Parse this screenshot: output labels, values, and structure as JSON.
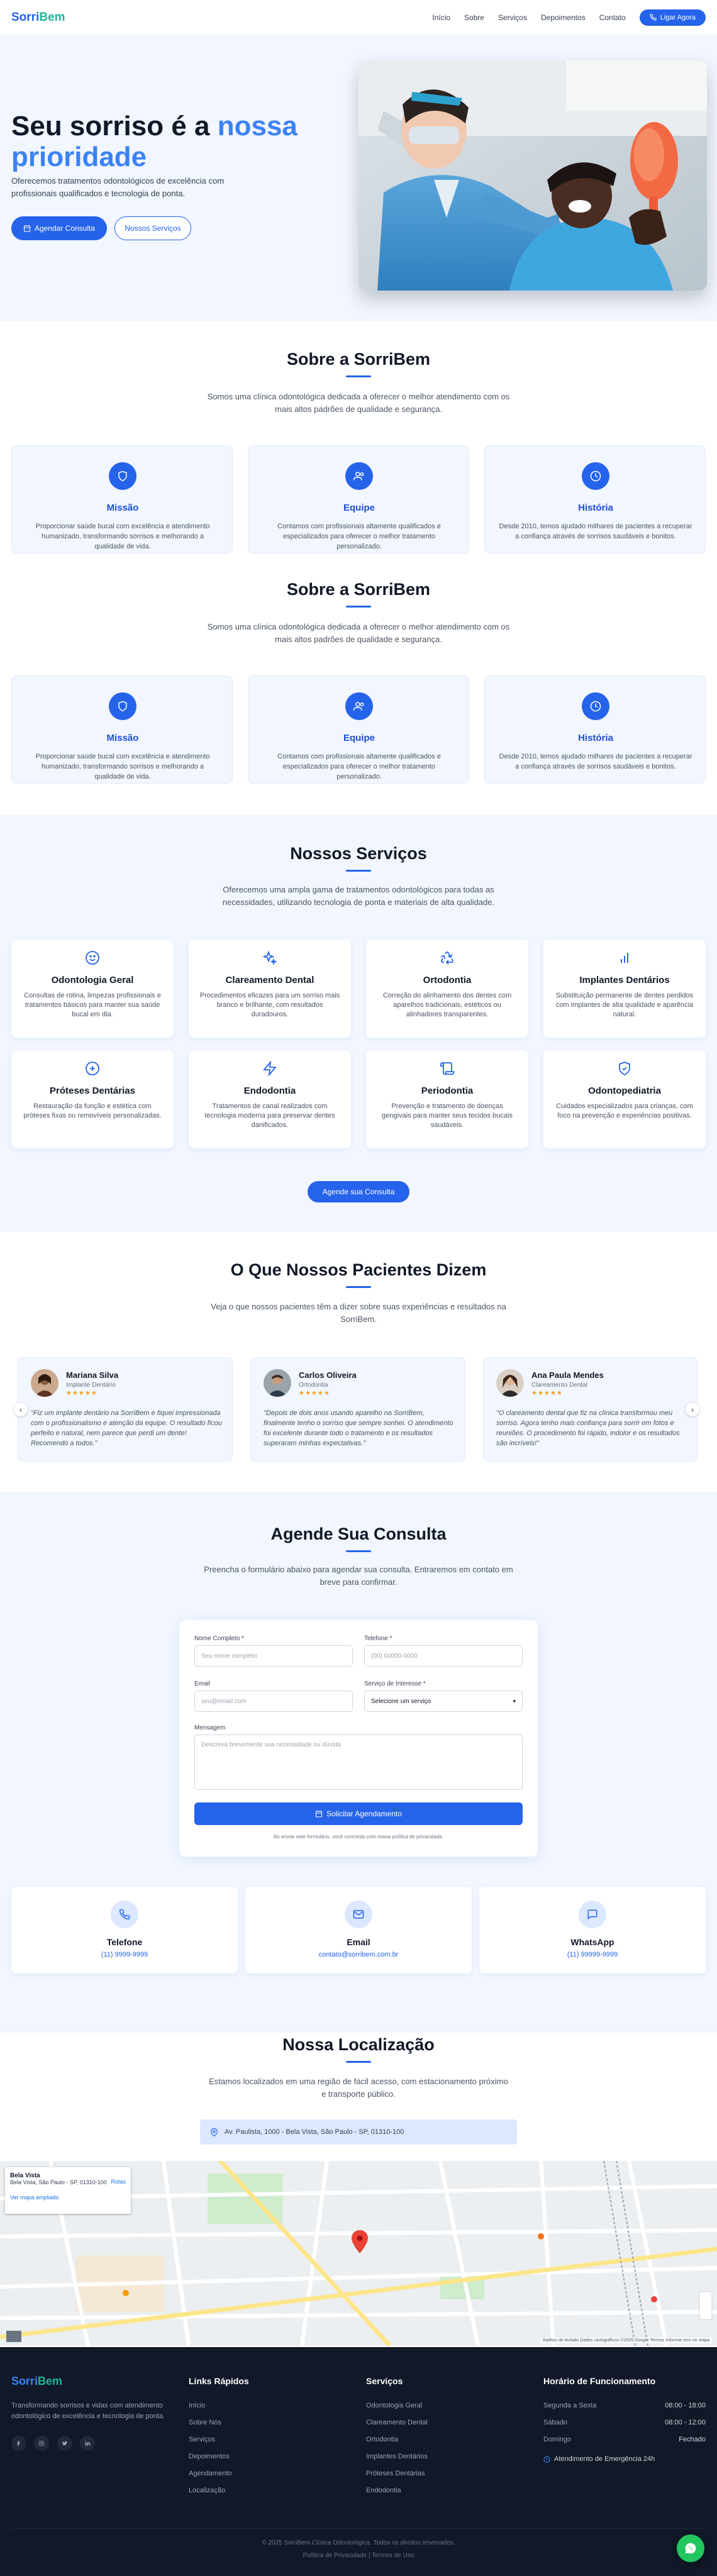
{
  "header": {
    "logo_part1": "Sorri",
    "logo_part2": "Bem",
    "nav": [
      "Início",
      "Sobre",
      "Serviços",
      "Depoimentos",
      "Contato"
    ],
    "cta": "Ligar Agora"
  },
  "hero": {
    "title_line1": "Seu sorriso é a",
    "title_highlight_1": "nossa",
    "title_highlight_2": "prioridade",
    "subtitle": "Oferecemos tratamentos odontológicos de excelência com profissionais qualificados e tecnologia de ponta.",
    "primary_button": "Agendar Consulta",
    "secondary_button": "Nossos Serviços"
  },
  "about": {
    "title": "Sobre a SorriBem",
    "subtitle": "Somos uma clínica odontológica dedicada a oferecer o melhor atendimento com os mais altos padrões de qualidade e segurança.",
    "cards": [
      {
        "title": "Missão",
        "text": "Proporcionar saúde bucal com excelência e atendimento humanizado, transformando sorrisos e melhorando a qualidade de vida."
      },
      {
        "title": "Equipe",
        "text": "Contamos com profissionais altamente qualificados e especializados para oferecer o melhor tratamento personalizado."
      },
      {
        "title": "História",
        "text": "Desde 2010, temos ajudado milhares de pacientes a recuperar a confiança através de sorrisos saudáveis e bonitos."
      }
    ]
  },
  "services": {
    "title": "Nossos Serviços",
    "subtitle": "Oferecemos uma ampla gama de tratamentos odontológicos para todas as necessidades, utilizando tecnologia de ponta e materiais de alta qualidade.",
    "items": [
      {
        "title": "Odontologia Geral",
        "text": "Consultas de rotina, limpezas profissionais e tratamentos básicos para manter sua saúde bucal em dia.",
        "icon": "smile-icon"
      },
      {
        "title": "Clareamento Dental",
        "text": "Procedimentos eficazes para um sorriso mais branco e brilhante, com resultados duradouros.",
        "icon": "sparkles-icon"
      },
      {
        "title": "Ortodontia",
        "text": "Correção do alinhamento dos dentes com aparelhos tradicionais, estéticos ou alinhadores transparentes.",
        "icon": "recycle-icon"
      },
      {
        "title": "Implantes Dentários",
        "text": "Substituição permanente de dentes perdidos com implantes de alta qualidade e aparência natural.",
        "icon": "bar-chart-icon"
      },
      {
        "title": "Próteses Dentárias",
        "text": "Restauração da função e estética com próteses fixas ou removíveis personalizadas.",
        "icon": "plus-circle-icon"
      },
      {
        "title": "Endodontia",
        "text": "Tratamentos de canal realizados com tecnologia moderna para preservar dentes danificados.",
        "icon": "lightning-icon"
      },
      {
        "title": "Periodontia",
        "text": "Prevenção e tratamento de doenças gengivais para manter seus tecidos bucais saudáveis.",
        "icon": "scroll-icon"
      },
      {
        "title": "Odontopediatria",
        "text": "Cuidados especializados para crianças, com foco na prevenção e experiências positivas.",
        "icon": "shield-check-icon"
      }
    ],
    "button": "Agende sua Consulta"
  },
  "testimonials": {
    "title": "O Que Nossos Pacientes Dizem",
    "subtitle": "Veja o que nossos pacientes têm a dizer sobre suas experiências e resultados na SorriBem.",
    "items": [
      {
        "name": "Mariana Silva",
        "role": "Implante Dentário",
        "stars": "★★★★★",
        "text": "\"Fiz um implante dentário na SorriBem e fiquei impressionada com o profissionalismo e atenção da equipe. O resultado ficou perfeito e natural, nem parece que perdi um dente! Recomendo a todos.\""
      },
      {
        "name": "Carlos Oliveira",
        "role": "Ortodontia",
        "stars": "★★★★★",
        "text": "\"Depois de dois anos usando aparelho na SorriBem, finalmente tenho o sorriso que sempre sonhei. O atendimento foi excelente durante todo o tratamento e os resultados superaram minhas expectativas.\""
      },
      {
        "name": "Ana Paula Mendes",
        "role": "Clareamento Dental",
        "stars": "★★★★★",
        "text": "\"O clareamento dental que fiz na clínica transformou meu sorriso. Agora tenho mais confiança para sorrir em fotos e reuniões. O procedimento foi rápido, indolor e os resultados são incríveis!\""
      }
    ]
  },
  "appointment": {
    "title": "Agende Sua Consulta",
    "subtitle": "Preencha o formulário abaixo para agendar sua consulta. Entraremos em contato em breve para confirmar.",
    "name_label": "Nome Completo *",
    "name_placeholder": "Seu nome completo",
    "phone_label": "Telefone *",
    "phone_placeholder": "(00) 00000-0000",
    "email_label": "Email",
    "email_placeholder": "seu@email.com",
    "service_label": "Serviço de Interesse *",
    "service_value": "Selecione um serviço",
    "message_label": "Mensagem",
    "message_placeholder": "Descreva brevemente sua necessidade ou dúvida",
    "submit": "Solicitar Agendamento",
    "privacy": "Ao enviar este formulário, você concorda com nossa política de privacidade."
  },
  "contacts": [
    {
      "title": "Telefone",
      "value": "(11) 9999-9999",
      "icon": "phone-icon"
    },
    {
      "title": "Email",
      "value": "contato@sorribem.com.br",
      "icon": "mail-icon"
    },
    {
      "title": "WhatsApp",
      "value": "(11) 99999-9999",
      "icon": "chat-icon"
    }
  ],
  "location": {
    "title": "Nossa Localização",
    "subtitle": "Estamos localizados em uma região de fácil acesso, com estacionamento próximo e transporte público.",
    "address": "Av. Paulista, 1000 - Bela Vista, São Paulo - SP, 01310-100",
    "map_card_title": "Bela Vista",
    "map_card_sub": "Bela Vista, São Paulo - SP, 01310-100",
    "map_card_link": "Ver mapa ampliado",
    "map_card_route": "Rotas",
    "map_footer": "Atalhos do teclado   Dados cartográficos ©2025 Google   Termos   Informar erro no mapa"
  },
  "footer": {
    "brand_part1": "Sorri",
    "brand_part2": "Bem",
    "about": "Transformando sorrisos e vidas com atendimento odontológico de excelência e tecnologia de ponta.",
    "links_title": "Links Rápidos",
    "links": [
      "Início",
      "Sobre Nós",
      "Serviços",
      "Depoimentos",
      "Agendamento",
      "Localização"
    ],
    "services_title": "Serviços",
    "services": [
      "Odontologia Geral",
      "Clareamento Dental",
      "Ortodontia",
      "Implantes Dentários",
      "Próteses Dentárias",
      "Endodontia"
    ],
    "hours_title": "Horário de Funcionamento",
    "hours": [
      {
        "day": "Segunda a Sexta",
        "time": "08:00 - 18:00"
      },
      {
        "day": "Sábado",
        "time": "08:00 - 12:00"
      },
      {
        "day": "Domingo",
        "time": "Fechado"
      }
    ],
    "emergency": "Atendimento de Emergência 24h",
    "copyright": "© 2025 SorriBem Clínica Odontológica. Todos os direitos reservados.",
    "policy": "Política de Privacidade | Termos de Uso"
  },
  "colors": {
    "primary": "#2563eb",
    "accent": "#1fb59a",
    "light_bg": "#f1f6ff",
    "footer_bg": "#111827",
    "whatsapp": "#22c55e"
  }
}
